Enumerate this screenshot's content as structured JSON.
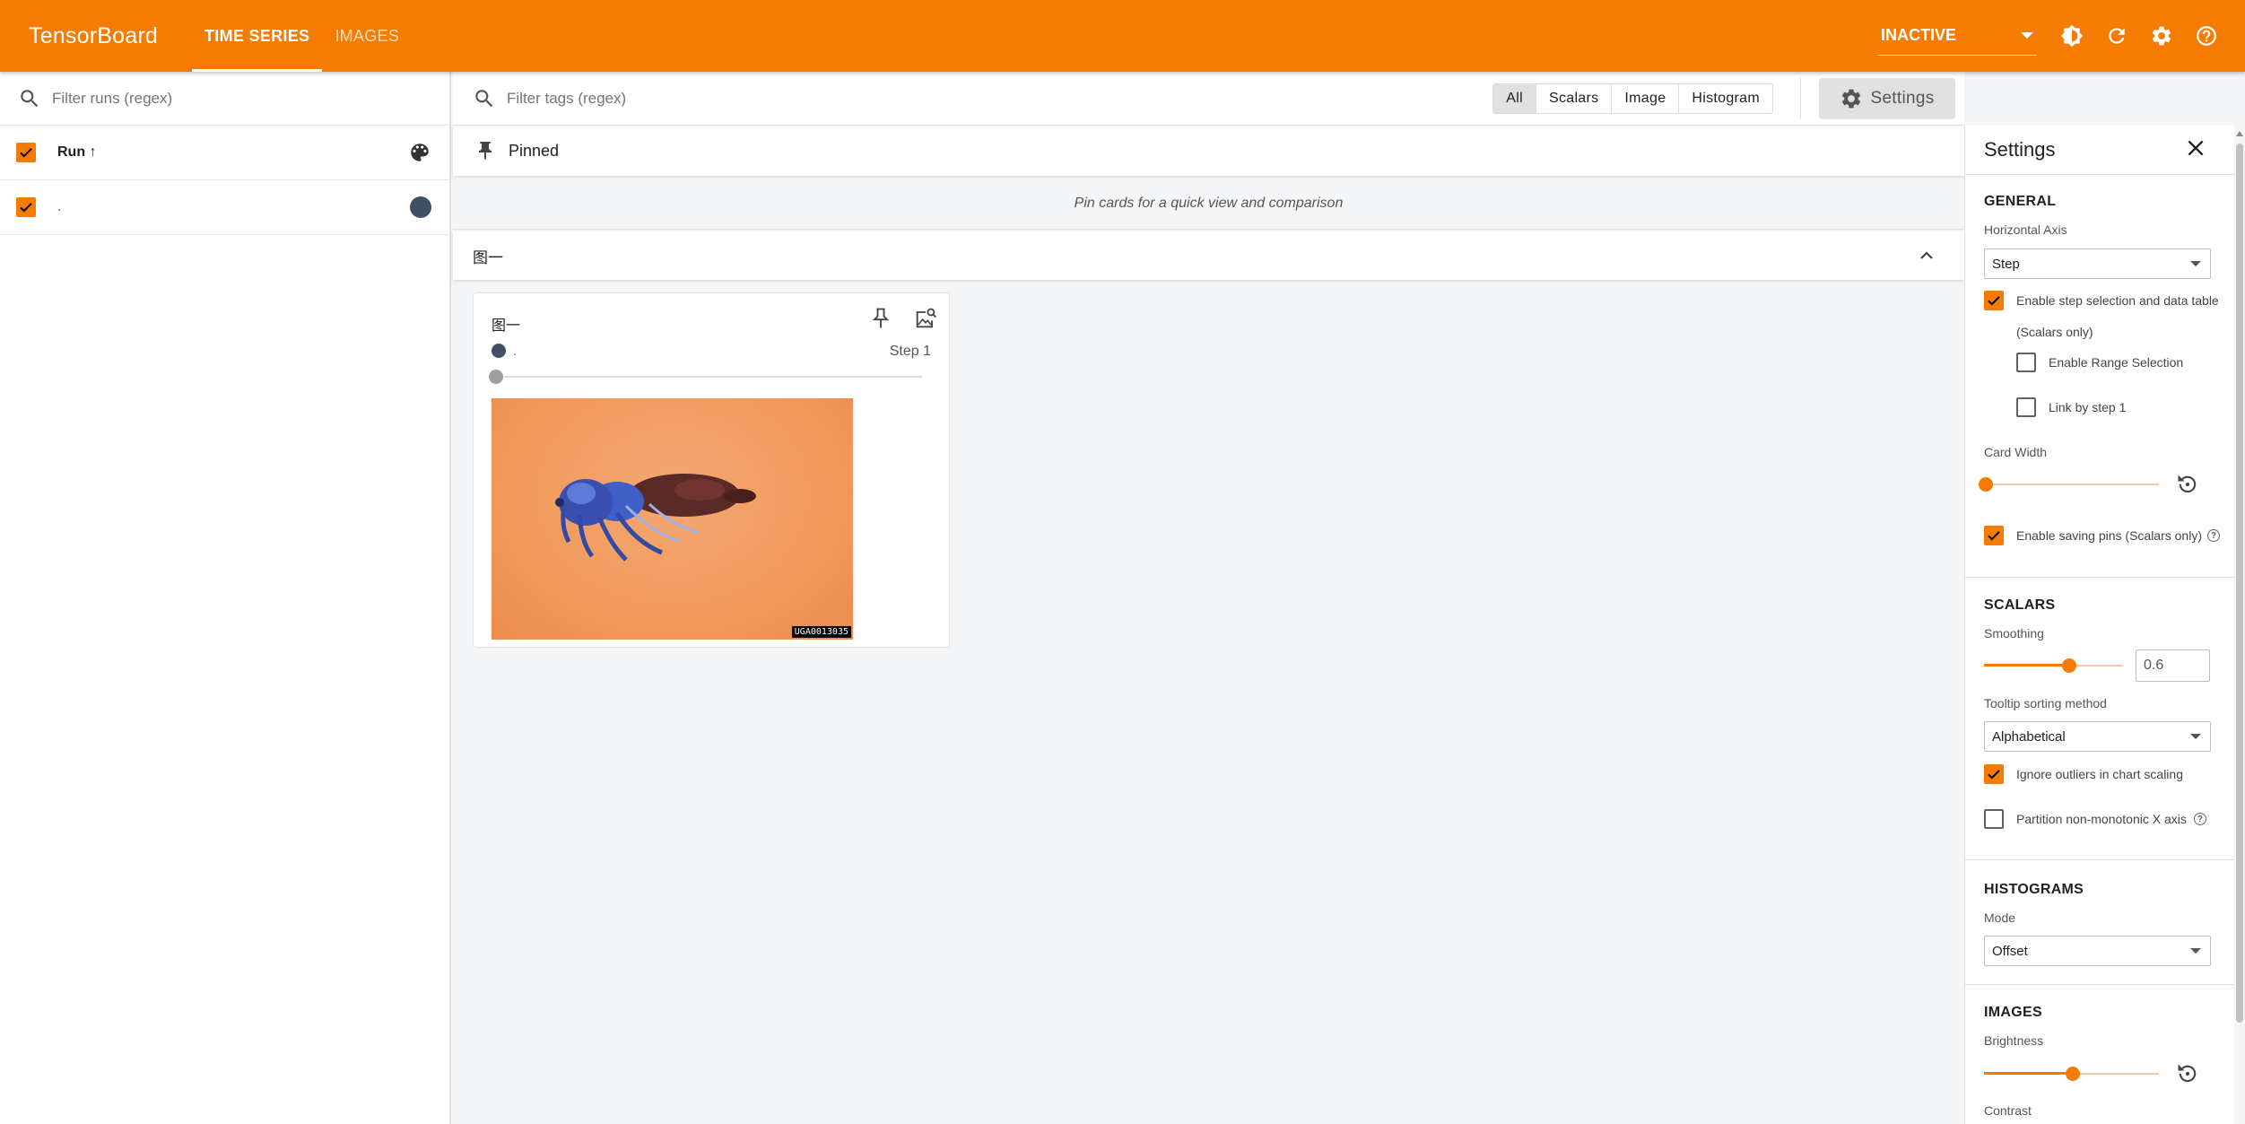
{
  "topbar": {
    "brand": "TensorBoard",
    "tabs": [
      {
        "label": "TIME SERIES",
        "active": true
      },
      {
        "label": "IMAGES",
        "active": false
      }
    ],
    "reload_status": "INACTIVE",
    "icons": [
      "theme-toggle-icon",
      "refresh-icon",
      "settings-gear-icon",
      "help-icon"
    ]
  },
  "runs": {
    "filter_placeholder": "Filter runs (regex)",
    "header_label": "Run ↑",
    "items": [
      {
        "name": ".",
        "checked": true,
        "color": "#425066"
      }
    ]
  },
  "main": {
    "filter_placeholder": "Filter tags (regex)",
    "type_filters": [
      "All",
      "Scalars",
      "Image",
      "Histogram"
    ],
    "selected_type": "All",
    "settings_button": "Settings",
    "pinned": {
      "title": "Pinned",
      "empty_message": "Pin cards for a quick view and comparison"
    },
    "group": {
      "title": "图一"
    },
    "card": {
      "title": "图一",
      "run_name": ".",
      "step_label": "Step 1",
      "image_tag": "UGA0013035"
    }
  },
  "settings": {
    "title": "Settings",
    "general": {
      "heading": "GENERAL",
      "horizontal_axis_label": "Horizontal Axis",
      "horizontal_axis_value": "Step",
      "step_selection_label": "Enable step selection and data table",
      "step_selection_sub": "(Scalars only)",
      "range_selection_label": "Enable Range Selection",
      "link_by_step_label": "Link by step 1",
      "card_width_label": "Card Width",
      "saving_pins_label": "Enable saving pins (Scalars only)"
    },
    "scalars": {
      "heading": "SCALARS",
      "smoothing_label": "Smoothing",
      "smoothing_value": "0.6",
      "smoothing_level": 0.6,
      "tooltip_sort_label": "Tooltip sorting method",
      "tooltip_sort_value": "Alphabetical",
      "ignore_outliers_label": "Ignore outliers in chart scaling",
      "partition_label": "Partition non-monotonic X axis"
    },
    "histograms": {
      "heading": "HISTOGRAMS",
      "mode_label": "Mode",
      "mode_value": "Offset"
    },
    "images": {
      "heading": "IMAGES",
      "brightness_label": "Brightness",
      "contrast_label": "Contrast"
    }
  },
  "colors": {
    "accent": "#f57c00",
    "run_color": "#425066"
  }
}
